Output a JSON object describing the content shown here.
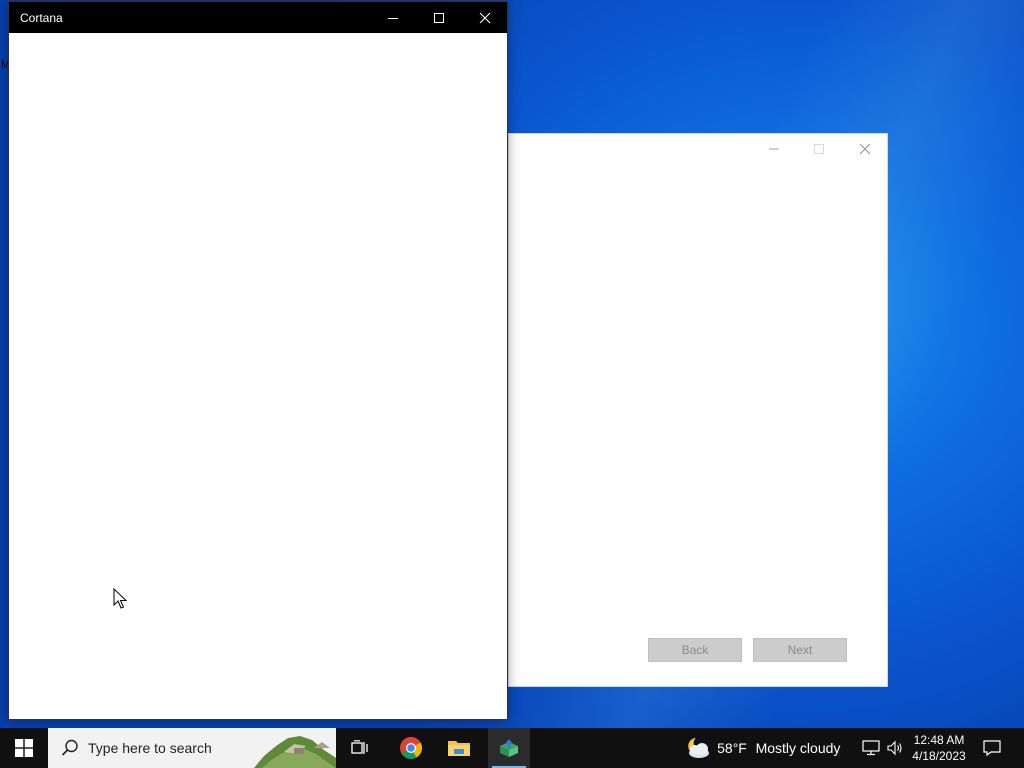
{
  "cortana_window": {
    "title": "Cortana"
  },
  "wizard_window": {
    "back_label": "Back",
    "next_label": "Next"
  },
  "desktop": {
    "stray_char": "M"
  },
  "taskbar": {
    "search_placeholder": "Type here to search",
    "weather_temp": "58°F",
    "weather_desc": "Mostly cloudy",
    "time": "12:48 AM",
    "date": "4/18/2023",
    "apps": [
      "task-view",
      "chrome",
      "file-explorer",
      "installer"
    ],
    "active_app": "installer"
  },
  "colors": {
    "taskbar": "#101010",
    "titlebar": "#000000",
    "accent": "#76b9ed"
  }
}
